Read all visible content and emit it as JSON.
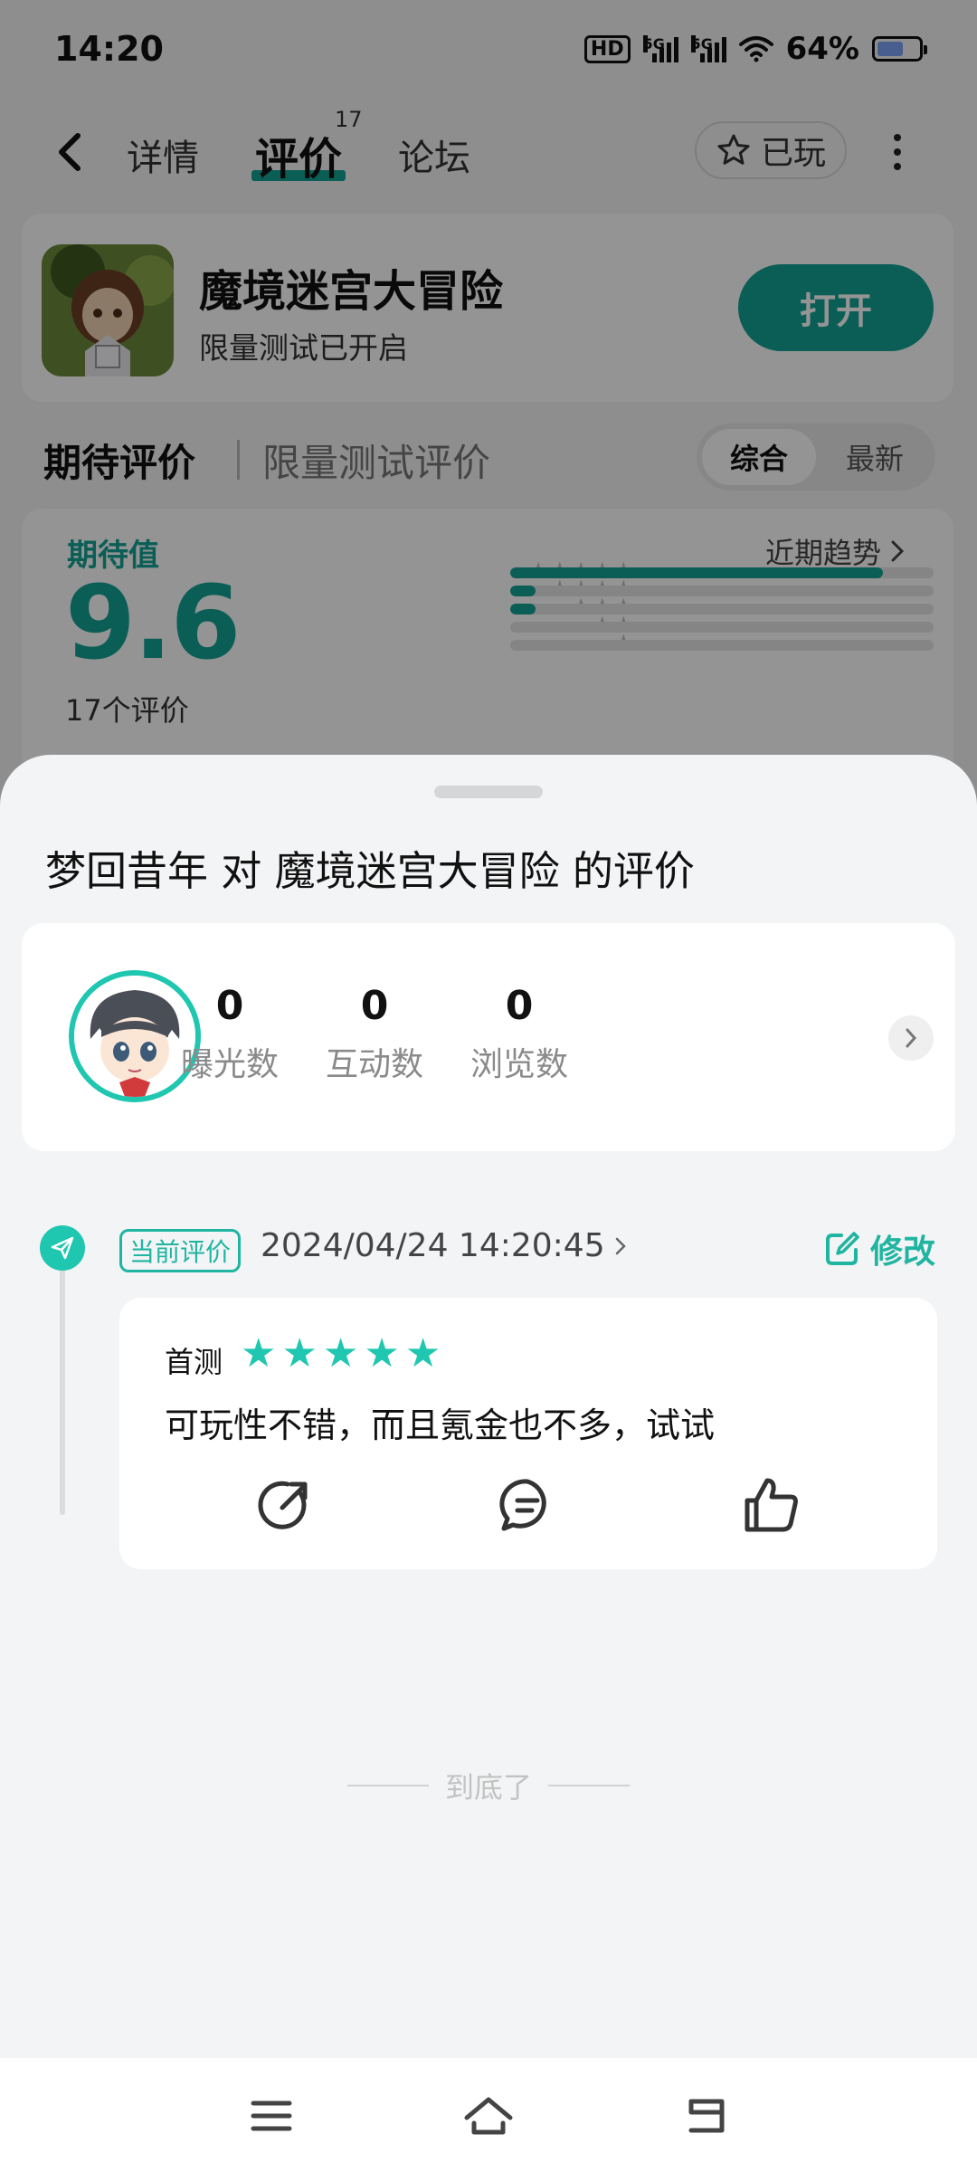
{
  "status_bar": {
    "time": "14:20",
    "network_badge": "HD",
    "signal1_label": "5G",
    "signal2_label": "5G",
    "battery_text": "64%",
    "battery_level": 0.64
  },
  "nav": {
    "tabs": [
      {
        "label": "详情"
      },
      {
        "label": "评价"
      },
      {
        "label": "论坛"
      }
    ],
    "active_tab_count": "17",
    "played_label": "已玩"
  },
  "app": {
    "name": "魔境迷宫大冒险",
    "subtitle": "限量测试已开启",
    "open_label": "打开"
  },
  "rating_header": {
    "title": "期待评价",
    "subtitle": "限量测试评价",
    "sort_options": [
      "综合",
      "最新"
    ],
    "sort_selected": "综合"
  },
  "score": {
    "label": "期待值",
    "value": "9.6",
    "count_text": "17个评价",
    "trend_label": "近期趋势",
    "distribution": [
      {
        "stars": 5,
        "fraction": 0.88
      },
      {
        "stars": 4,
        "fraction": 0.06
      },
      {
        "stars": 3,
        "fraction": 0.06
      },
      {
        "stars": 2,
        "fraction": 0.0
      },
      {
        "stars": 1,
        "fraction": 0.0
      }
    ]
  },
  "sheet": {
    "title": "梦回昔年 对 魔境迷宫大冒险 的评价",
    "stats": [
      {
        "value": "0",
        "label": "曝光数"
      },
      {
        "value": "0",
        "label": "互动数"
      },
      {
        "value": "0",
        "label": "浏览数"
      }
    ],
    "current_tag": "当前评价",
    "review_time": "2024/04/24 14:20:45",
    "edit_label": "修改",
    "review": {
      "label": "首测",
      "rating": 5,
      "text": "可玩性不错，而且氪金也不多，试试"
    },
    "end_text": "到底了"
  },
  "colors": {
    "accent": "#14a394",
    "accent_light": "#1fc7b0"
  }
}
